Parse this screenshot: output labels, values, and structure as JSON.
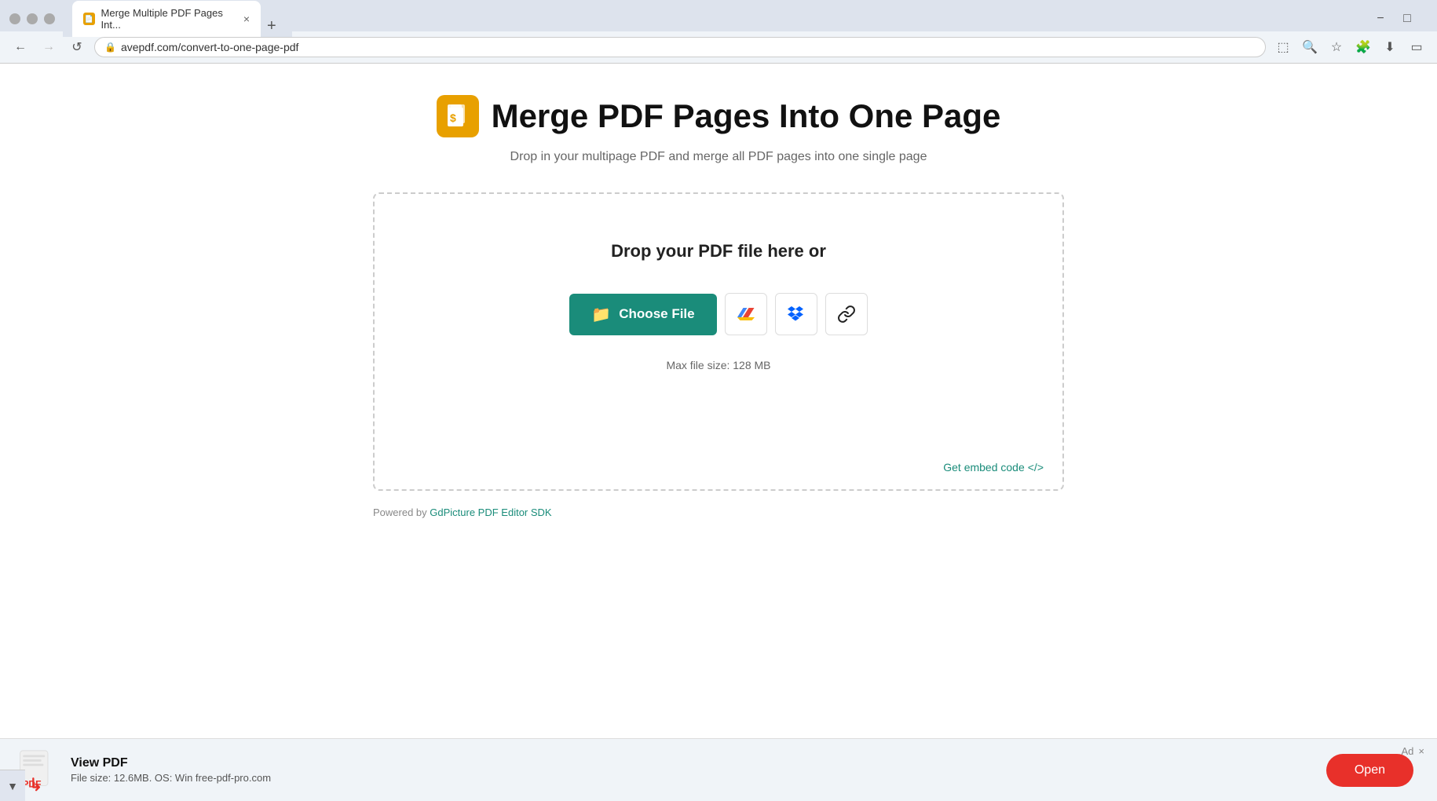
{
  "browser": {
    "tab_title": "Merge Multiple PDF Pages Int...",
    "tab_close": "×",
    "tab_new": "+",
    "back_btn": "←",
    "forward_btn": "→",
    "refresh_btn": "↺",
    "url": "avepdf.com/convert-to-one-page-pdf",
    "nav_actions": {
      "screen_cast": "⬚",
      "zoom": "🔍",
      "bookmark": "☆",
      "extensions": "🧩",
      "download": "⬇",
      "profile": "▭"
    }
  },
  "page": {
    "title": "Merge PDF Pages Into One Page",
    "subtitle": "Drop in your multipage PDF and merge all PDF pages into one single page",
    "logo_symbol": "📄"
  },
  "dropzone": {
    "drop_text": "Drop your PDF file here or",
    "choose_file_label": "Choose File",
    "max_file_size": "Max file size: 128 MB",
    "embed_code_label": "Get embed code",
    "embed_code_icon": "</>"
  },
  "source_buttons": [
    {
      "id": "google-drive",
      "icon": "drive",
      "tooltip": "Google Drive"
    },
    {
      "id": "dropbox",
      "icon": "dropbox",
      "tooltip": "Dropbox"
    },
    {
      "id": "url",
      "icon": "link",
      "tooltip": "URL"
    }
  ],
  "powered_by": {
    "prefix": "Powered by ",
    "link_text": "GdPicture PDF Editor SDK"
  },
  "ad": {
    "title": "View PDF",
    "subtitle": "File size: 12.6MB. OS: Win free-pdf-pro.com",
    "open_label": "Open",
    "ad_label": "Ad",
    "close_label": "×"
  }
}
